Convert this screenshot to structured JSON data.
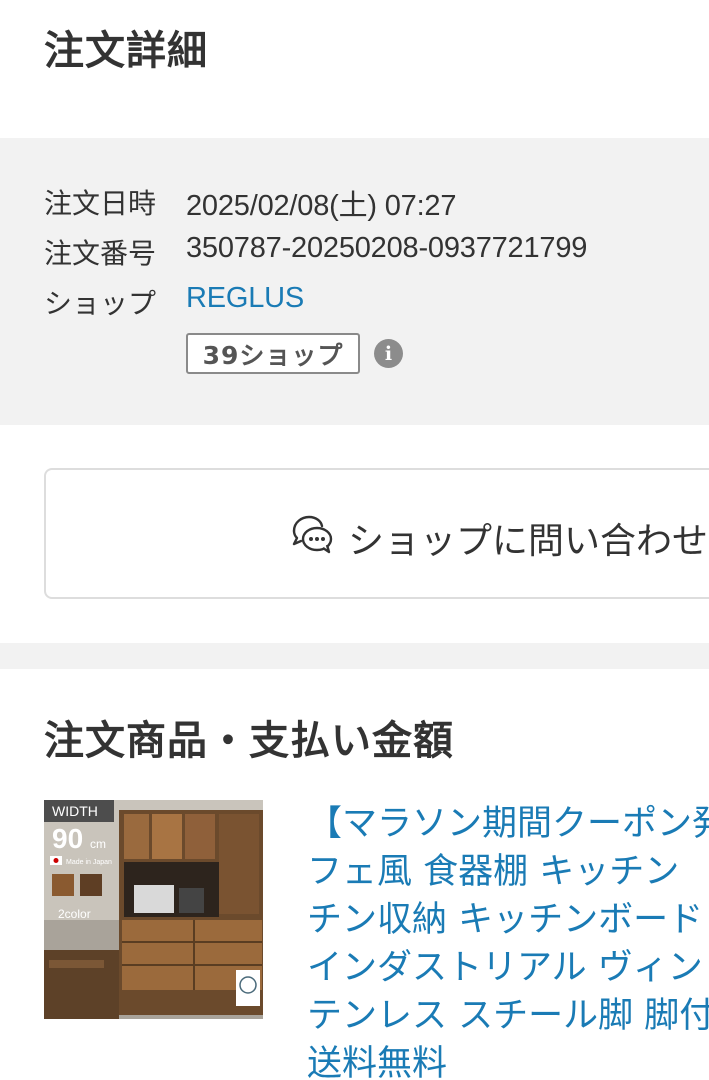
{
  "page": {
    "title": "注文詳細"
  },
  "order_info": {
    "date_label": "注文日時",
    "date_value": "2025/02/08(土) 07:27",
    "number_label": "注文番号",
    "number_value": "350787-20250208-0937721799",
    "shop_label": "ショップ",
    "shop_name": "REGLUS",
    "badge": "39ショップ",
    "info_icon": "i"
  },
  "contact": {
    "label": "ショップに問い合わせ"
  },
  "section": {
    "title": "注文商品・支払い金額"
  },
  "product": {
    "thumb_width_label": "WIDTH",
    "thumb_width_value": "90",
    "thumb_width_unit": "cm",
    "thumb_made_in": "Made in Japan",
    "thumb_color": "2color",
    "title_lines": [
      "【マラソン期間クーポン発",
      "フェ風 食器棚 キッチン",
      "チン収納 キッチンボード",
      "インダストリアル ヴィン",
      "テンレス スチール脚 脚付",
      "送料無料"
    ]
  },
  "colors": {
    "link": "#1a7bb5",
    "background_gray": "#f2f2f2",
    "text": "#333333"
  }
}
